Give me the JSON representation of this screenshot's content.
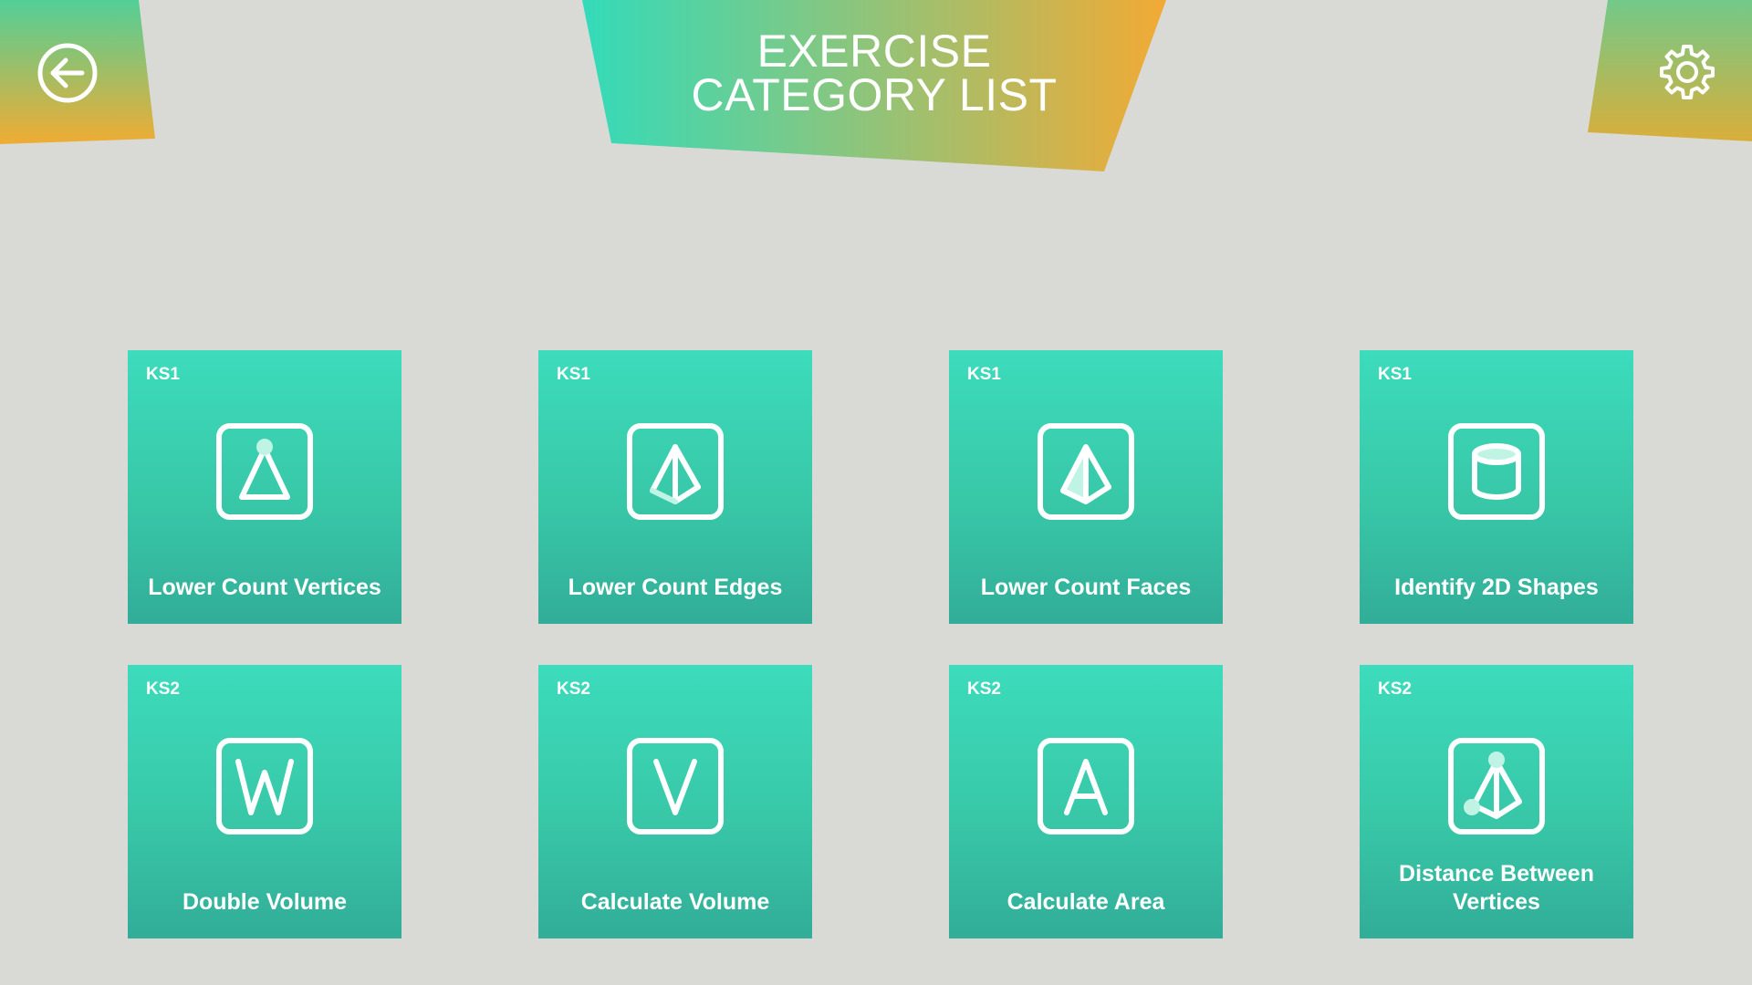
{
  "header": {
    "title_line1": "EXERCISE",
    "title_line2": "CATEGORY LIST",
    "back_icon": "arrow-left-circle",
    "settings_icon": "gear"
  },
  "colors": {
    "background": "#d9dad6",
    "accent_teal": "#35d8b6",
    "accent_orange": "#f0aa35",
    "tile_top": "#3cdcbc",
    "tile_bottom": "#32ad98"
  },
  "categories": [
    {
      "stage": "KS1",
      "label": "Lower Count Vertices",
      "icon": "triangle-vertex"
    },
    {
      "stage": "KS1",
      "label": "Lower Count Edges",
      "icon": "pyramid-edges"
    },
    {
      "stage": "KS1",
      "label": "Lower Count Faces",
      "icon": "pyramid-faces"
    },
    {
      "stage": "KS1",
      "label": "Identify 2D Shapes",
      "icon": "cylinder"
    },
    {
      "stage": "KS2",
      "label": "Double Volume",
      "icon": "letter-w"
    },
    {
      "stage": "KS2",
      "label": "Calculate Volume",
      "icon": "letter-v"
    },
    {
      "stage": "KS2",
      "label": "Calculate Area",
      "icon": "letter-a"
    },
    {
      "stage": "KS2",
      "label": "Distance Between Vertices",
      "icon": "pyramid-vertices"
    }
  ]
}
